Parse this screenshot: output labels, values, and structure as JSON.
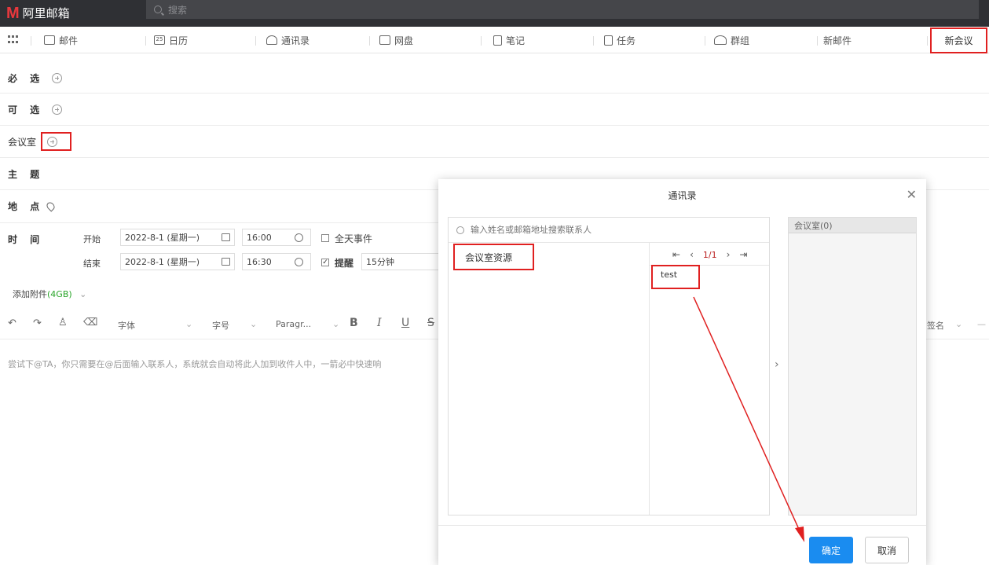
{
  "app": {
    "logo_mark": "M",
    "logo_text": "阿里邮箱",
    "search_placeholder": "搜索"
  },
  "nav": {
    "items": [
      {
        "label": "邮件",
        "icon": "mail-icon"
      },
      {
        "label": "日历",
        "icon": "calendar-icon",
        "icon_text": "25"
      },
      {
        "label": "通讯录",
        "icon": "contacts-icon"
      },
      {
        "label": "网盘",
        "icon": "drive-icon"
      },
      {
        "label": "笔记",
        "icon": "notes-icon"
      },
      {
        "label": "任务",
        "icon": "tasks-icon"
      },
      {
        "label": "群组",
        "icon": "group-icon"
      },
      {
        "label": "新邮件"
      },
      {
        "label": "新会议"
      }
    ]
  },
  "form": {
    "required_label": "必 选",
    "optional_label": "可 选",
    "room_label": "会议室",
    "subject_label": "主 题",
    "location_label": "地 点",
    "time_label": "时 间",
    "start_label": "开始",
    "end_label": "结束",
    "start_date": "2022-8-1 (星期一)",
    "start_time": "16:00",
    "end_date": "2022-8-1 (星期一)",
    "end_time": "16:30",
    "all_day_label": "全天事件",
    "reminder_label": "提醒",
    "reminder_value": "15分钟",
    "attach_label": "添加附件",
    "attach_size": "(4GB)",
    "font_label": "字体",
    "size_label": "字号",
    "paragraph_label": "Paragr...",
    "signature_label": "签名",
    "editor_hint": "尝试下@TA，你只需要在@后面输入联系人，系统就会自动将此人加到收件人中，一箭必中快速响"
  },
  "dialog": {
    "title": "通讯录",
    "search_placeholder": "输入姓名或邮箱地址搜索联系人",
    "group_item": "会议室资源",
    "page": "1/1",
    "result_item": "test",
    "selected_header": "会议室(0)",
    "ok_label": "确定",
    "cancel_label": "取消"
  },
  "colors": {
    "highlight": "#e02020",
    "primary": "#1a8cf0",
    "topbar": "#2f3034",
    "logo": "#e8383d"
  }
}
